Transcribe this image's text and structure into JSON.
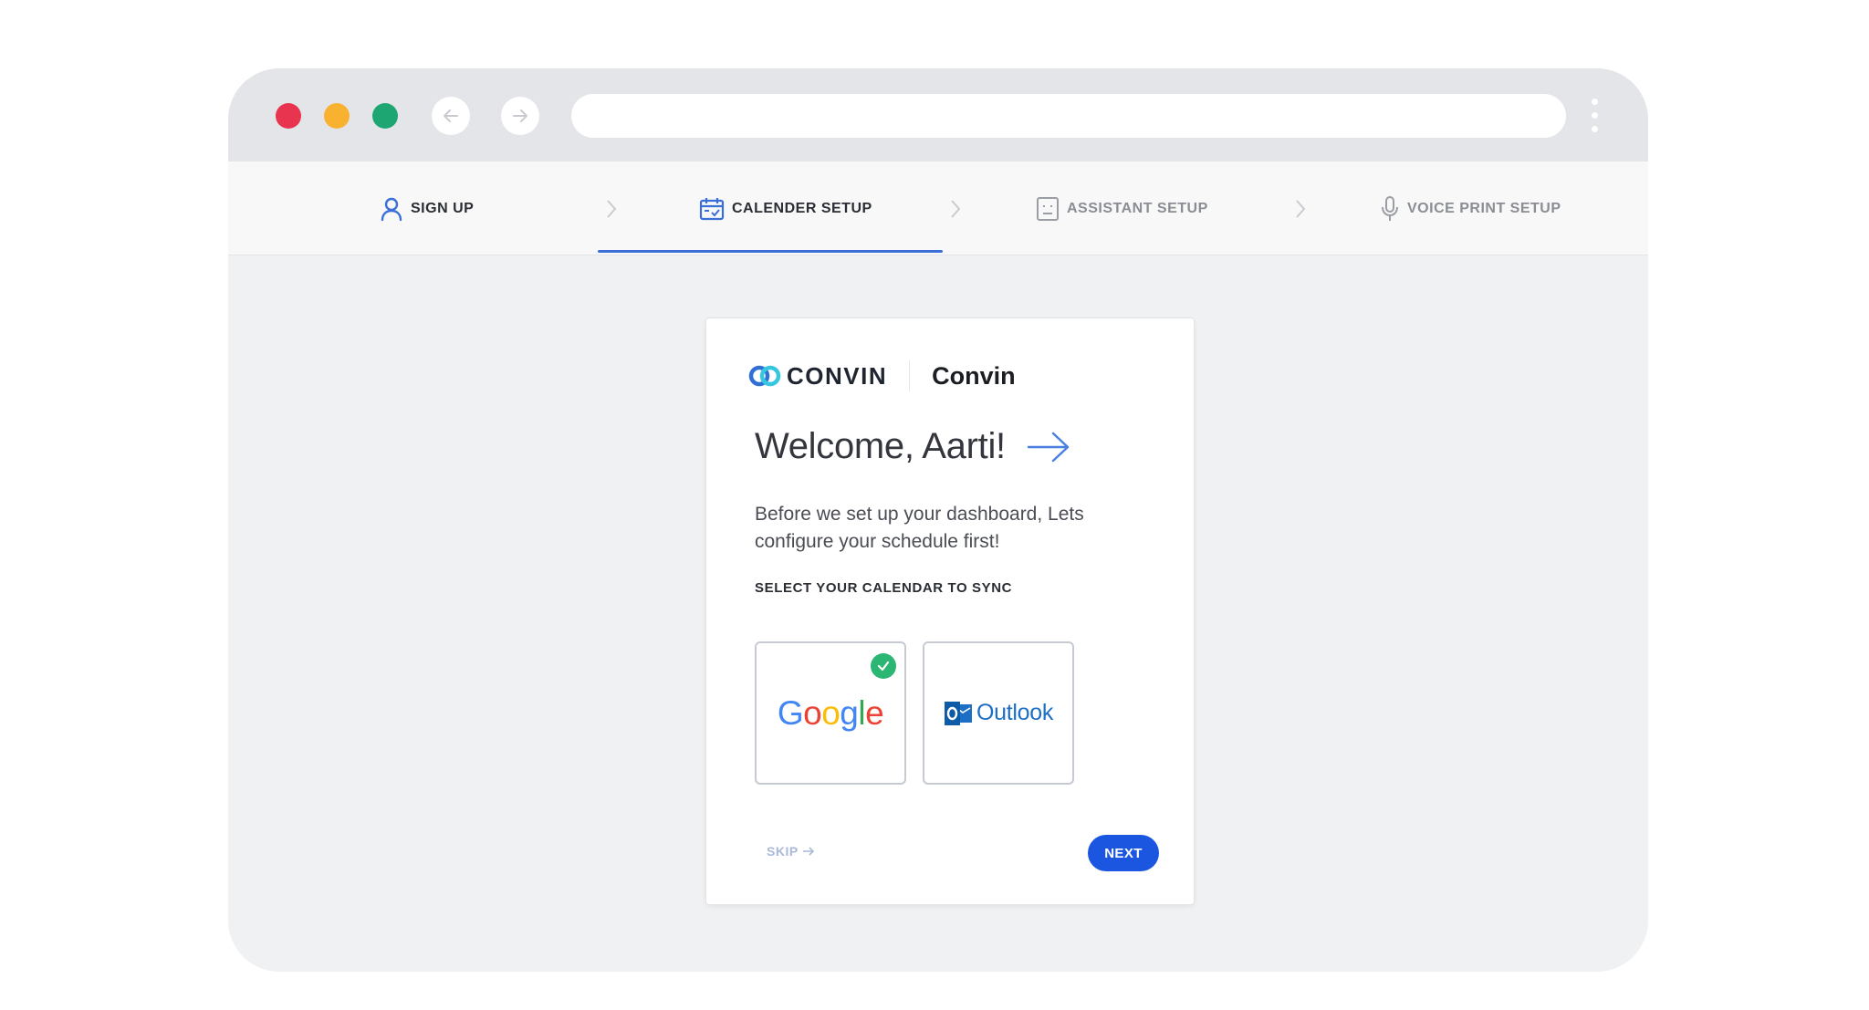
{
  "browser": {
    "traffic_lights": {
      "close": "#e8344e",
      "minimize": "#f8b230",
      "maximize": "#1ea672"
    },
    "url": ""
  },
  "steps": [
    {
      "label": "SIGN UP",
      "icon": "user-icon",
      "state": "done"
    },
    {
      "label": "CALENDER SETUP",
      "icon": "calendar-icon",
      "state": "active"
    },
    {
      "label": "ASSISTANT SETUP",
      "icon": "assistant-icon",
      "state": "pending"
    },
    {
      "label": "VOICE PRINT SETUP",
      "icon": "microphone-icon",
      "state": "pending"
    }
  ],
  "card": {
    "brand_logo_text": "CONVIN",
    "brand_name": "Convin",
    "welcome": "Welcome, Aarti!",
    "description": "Before we set up your dashboard, Lets configure your schedule first!",
    "section_label": "SELECT YOUR CALENDAR TO SYNC",
    "options": [
      {
        "label": "Google",
        "selected": true
      },
      {
        "label": "Outlook",
        "selected": false
      }
    ],
    "skip_label": "SKIP",
    "next_label": "NEXT"
  },
  "colors": {
    "accent": "#3b6fd8",
    "next_button": "#1a56e0",
    "selected_check": "#2bb673"
  }
}
